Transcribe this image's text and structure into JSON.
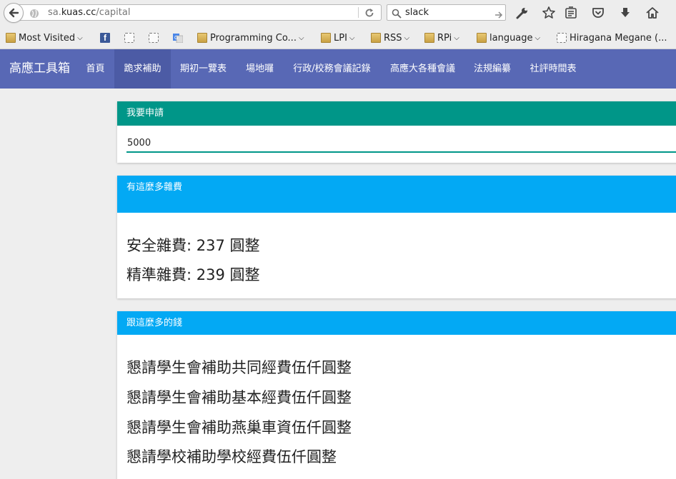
{
  "browser": {
    "url_prefix": "sa.",
    "url_host": "kuas.cc",
    "url_path": "/capital",
    "search_text": "slack"
  },
  "bookmarks": [
    {
      "label": "Most Visited",
      "icon": "most-visited-icon",
      "dropdown": true
    },
    {
      "label": "",
      "icon": "facebook-icon",
      "dropdown": false
    },
    {
      "label": "",
      "icon": "blank-page-icon",
      "dropdown": false
    },
    {
      "label": "",
      "icon": "blank-page-icon",
      "dropdown": false
    },
    {
      "label": "",
      "icon": "google-translate-icon",
      "dropdown": false
    },
    {
      "label": "Programming Co...",
      "icon": "folder-icon",
      "dropdown": true
    },
    {
      "label": "LPI",
      "icon": "folder-icon",
      "dropdown": true
    },
    {
      "label": "RSS",
      "icon": "folder-icon",
      "dropdown": true
    },
    {
      "label": "RPi",
      "icon": "folder-icon",
      "dropdown": true
    },
    {
      "label": "language",
      "icon": "folder-icon",
      "dropdown": true
    },
    {
      "label": "Hiragana Megane (...",
      "icon": "blank-page-icon",
      "dropdown": false
    }
  ],
  "navbar": {
    "brand": "高應工具箱",
    "items": [
      "首頁",
      "跪求補助",
      "期初一覽表",
      "場地囉",
      "行政/校務會議記錄",
      "高應大各種會議",
      "法規編纂",
      "社評時間表"
    ],
    "active_index": 1
  },
  "apply_card": {
    "title": "我要申請",
    "amount_value": "5000"
  },
  "fees_card": {
    "title": "有這麼多雜費",
    "lines": [
      "安全雜費: 237 圓整",
      "精準雜費: 239 圓整"
    ]
  },
  "money_card": {
    "title": "跟這麼多的錢",
    "lines": [
      "懇請學生會補助共同經費伍仟圓整",
      "懇請學生會補助基本經費伍仟圓整",
      "懇請學生會補助燕巢車資伍仟圓整",
      "懇請學校補助學校經費伍仟圓整"
    ]
  },
  "colors": {
    "navbar": "#5868b5",
    "card_head_green": "#009688",
    "card_head_blue": "#03a9f4"
  }
}
